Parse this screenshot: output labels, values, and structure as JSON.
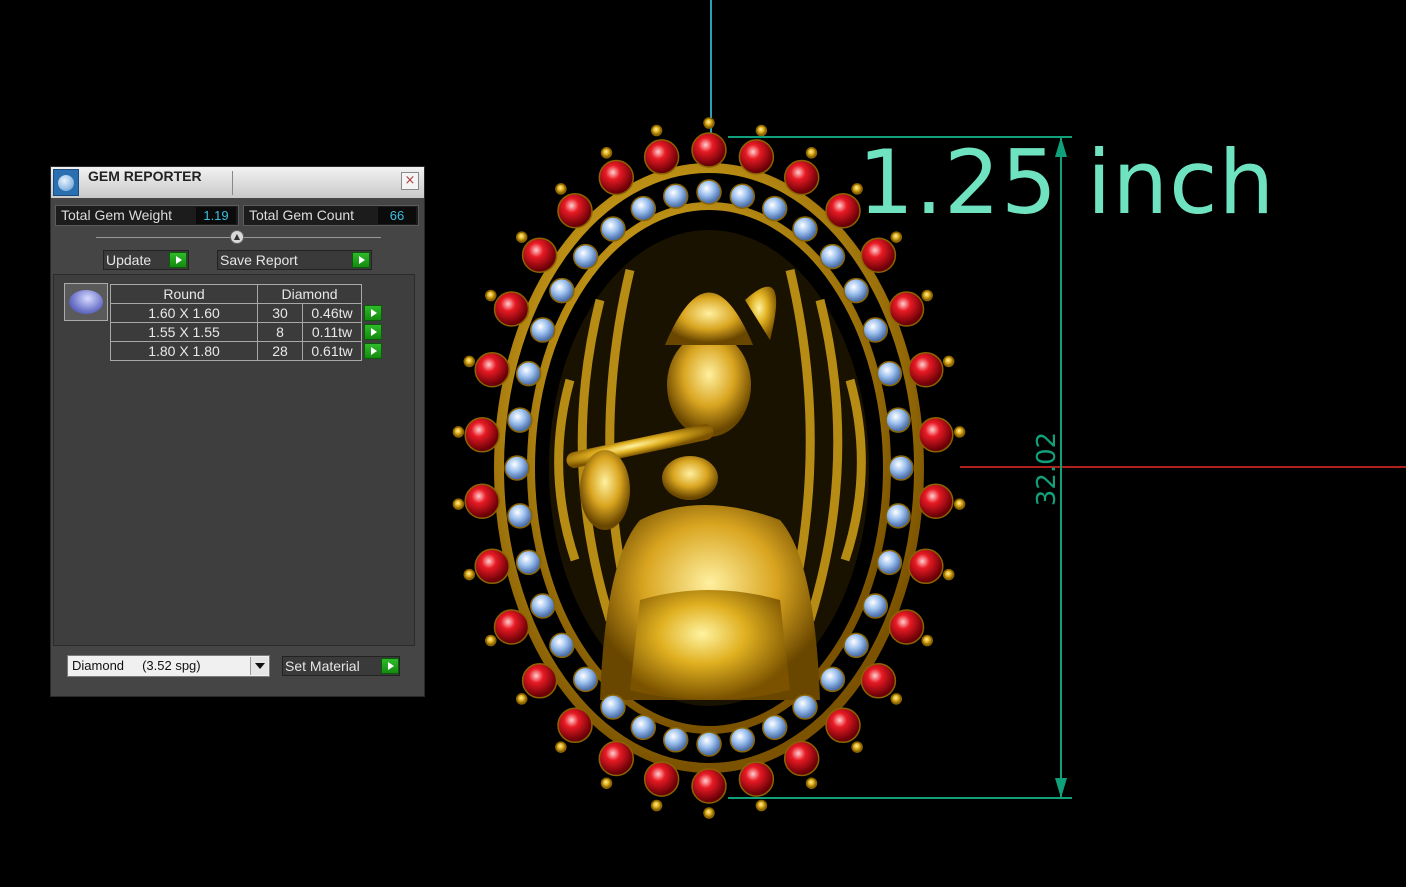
{
  "panel": {
    "title": "GEM REPORTER",
    "close_label": "×",
    "total_weight_label": "Total Gem Weight",
    "total_weight_value": "1.19",
    "total_count_label": "Total Gem Count",
    "total_count_value": "66",
    "update_label": "Update",
    "save_report_label": "Save Report",
    "table": {
      "headers": [
        "Round",
        "Diamond"
      ],
      "rows": [
        {
          "size": "1.60 X 1.60",
          "count": "30",
          "weight": "0.46tw"
        },
        {
          "size": "1.55 X 1.55",
          "count": "8",
          "weight": "0.11tw"
        },
        {
          "size": "1.80 X 1.80",
          "count": "28",
          "weight": "0.61tw"
        }
      ]
    },
    "material_value": "Diamond     (3.52 spg)",
    "set_material_label": "Set Material"
  },
  "viewport": {
    "dimension_label": "1.25 inch",
    "dimension_value": "32.02"
  },
  "colors": {
    "axis_vertical": "#2aa0b8",
    "axis_horizontal": "#b0201c",
    "dimension": "#10a07a",
    "dimension_text": "#6fe3c0",
    "gold": "#d4a017",
    "ruby": "#d2141e",
    "diamond": "#8fb4e6"
  }
}
